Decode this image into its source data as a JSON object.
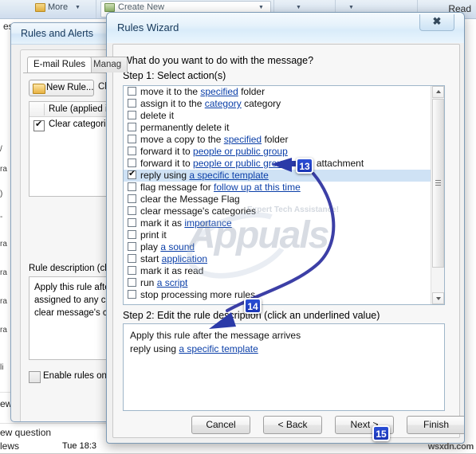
{
  "background_app": {
    "ribbon": {
      "more_label": "More",
      "create_new_label": "Create New",
      "read_label": "Read",
      "respond_label": "espond"
    },
    "mail_list": [
      {
        "subject": "ew question",
        "date": ""
      },
      {
        "subject": "",
        "date": "Tue 18:"
      },
      {
        "subject": "ew question",
        "date": ""
      },
      {
        "subject": "lews",
        "date": "Tue 18:3"
      }
    ]
  },
  "rules_and_alerts": {
    "title": "Rules and Alerts",
    "tabs": [
      {
        "label": "E-mail Rules",
        "active": true
      },
      {
        "label": "Manag",
        "active": false
      }
    ],
    "new_rule_button": "New Rule...",
    "change_button": "Ch",
    "list_header": "Rule (applied in",
    "rules": [
      {
        "name": "Clear categories",
        "checked": true
      }
    ],
    "description_label": "Rule description (click",
    "description_lines": [
      "Apply this rule afte",
      "assigned to any ca",
      "clear message's ca"
    ],
    "enable_rules_label": "Enable rules on a",
    "enable_rules_checked": false
  },
  "wizard": {
    "title": "Rules Wizard",
    "close_glyph": "✖",
    "question": "What do you want to do with the message?",
    "step1_label": "Step 1: Select action(s)",
    "actions": [
      {
        "parts": [
          {
            "t": "move it to the ",
            "link": false
          },
          {
            "t": "specified",
            "link": true
          },
          {
            "t": " folder",
            "link": false
          }
        ],
        "checked": false,
        "selected": false
      },
      {
        "parts": [
          {
            "t": "assign it to the ",
            "link": false
          },
          {
            "t": "category",
            "link": true
          },
          {
            "t": " category",
            "link": false
          }
        ],
        "checked": false,
        "selected": false
      },
      {
        "parts": [
          {
            "t": "delete it",
            "link": false
          }
        ],
        "checked": false,
        "selected": false
      },
      {
        "parts": [
          {
            "t": "permanently delete it",
            "link": false
          }
        ],
        "checked": false,
        "selected": false
      },
      {
        "parts": [
          {
            "t": "move a copy to the ",
            "link": false
          },
          {
            "t": "specified",
            "link": true
          },
          {
            "t": " folder",
            "link": false
          }
        ],
        "checked": false,
        "selected": false
      },
      {
        "parts": [
          {
            "t": "forward it to ",
            "link": false
          },
          {
            "t": "people or public group",
            "link": true
          }
        ],
        "checked": false,
        "selected": false
      },
      {
        "parts": [
          {
            "t": "forward it to ",
            "link": false
          },
          {
            "t": "people or public group",
            "link": true
          },
          {
            "t": " as an attachment",
            "link": false
          }
        ],
        "checked": false,
        "selected": false
      },
      {
        "parts": [
          {
            "t": "reply using ",
            "link": false
          },
          {
            "t": "a specific template",
            "link": true
          }
        ],
        "checked": true,
        "selected": true
      },
      {
        "parts": [
          {
            "t": "flag message for ",
            "link": false
          },
          {
            "t": "follow up at this time",
            "link": true
          }
        ],
        "checked": false,
        "selected": false
      },
      {
        "parts": [
          {
            "t": "clear the Message Flag",
            "link": false
          }
        ],
        "checked": false,
        "selected": false
      },
      {
        "parts": [
          {
            "t": "clear message's categories",
            "link": false
          }
        ],
        "checked": false,
        "selected": false
      },
      {
        "parts": [
          {
            "t": "mark it as ",
            "link": false
          },
          {
            "t": "importance",
            "link": true
          }
        ],
        "checked": false,
        "selected": false
      },
      {
        "parts": [
          {
            "t": "print it",
            "link": false
          }
        ],
        "checked": false,
        "selected": false
      },
      {
        "parts": [
          {
            "t": "play ",
            "link": false
          },
          {
            "t": "a sound",
            "link": true
          }
        ],
        "checked": false,
        "selected": false
      },
      {
        "parts": [
          {
            "t": "start ",
            "link": false
          },
          {
            "t": "application",
            "link": true
          }
        ],
        "checked": false,
        "selected": false
      },
      {
        "parts": [
          {
            "t": "mark it as read",
            "link": false
          }
        ],
        "checked": false,
        "selected": false
      },
      {
        "parts": [
          {
            "t": "run ",
            "link": false
          },
          {
            "t": "a script",
            "link": true
          }
        ],
        "checked": false,
        "selected": false
      },
      {
        "parts": [
          {
            "t": "stop processing more rules",
            "link": false
          }
        ],
        "checked": false,
        "selected": false
      }
    ],
    "step2_label": "Step 2: Edit the rule description (click an underlined value)",
    "description_lines": [
      {
        "parts": [
          {
            "t": "Apply this rule after the message arrives",
            "link": false
          }
        ]
      },
      {
        "parts": [
          {
            "t": "reply using ",
            "link": false
          },
          {
            "t": "a specific template",
            "link": true
          }
        ]
      }
    ],
    "buttons": {
      "cancel": "Cancel",
      "back": "< Back",
      "next": "Next >",
      "finish": "Finish"
    }
  },
  "annotations": [
    {
      "id": "13",
      "label": "13"
    },
    {
      "id": "14",
      "label": "14"
    },
    {
      "id": "15",
      "label": "15"
    }
  ],
  "watermarks": {
    "brand": "Appuals",
    "tagline": "Expert Tech Assistance!",
    "corner": "wsxdn.com"
  },
  "colors": {
    "selection_blue": "#cfe2f5",
    "link_blue": "#0b3fa8",
    "badge_blue": "#1a35b5",
    "titlebar_blue": "#d9ecfa"
  }
}
